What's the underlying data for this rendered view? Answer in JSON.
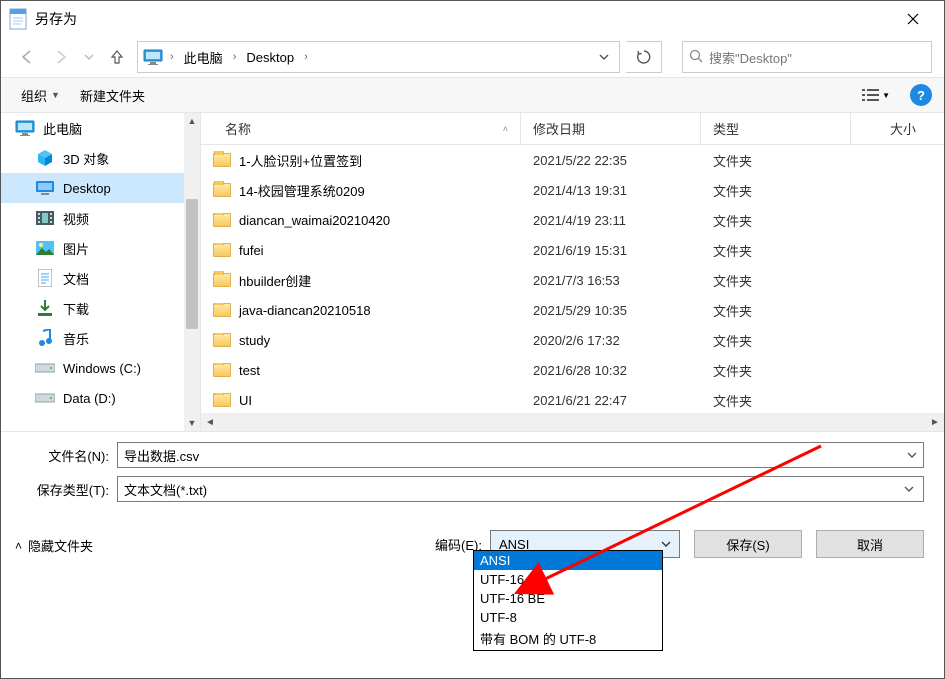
{
  "window": {
    "title": "另存为"
  },
  "nav": {
    "breadcrumb": {
      "root": "此电脑",
      "folder": "Desktop"
    },
    "search_placeholder": "搜索\"Desktop\""
  },
  "toolbar": {
    "organize": "组织",
    "new_folder": "新建文件夹"
  },
  "sidebar": {
    "items": [
      {
        "label": "此电脑",
        "icon": "monitor",
        "indent": 0
      },
      {
        "label": "3D 对象",
        "icon": "cube",
        "indent": 1
      },
      {
        "label": "Desktop",
        "icon": "desktop",
        "indent": 1,
        "selected": true
      },
      {
        "label": "视频",
        "icon": "video",
        "indent": 1
      },
      {
        "label": "图片",
        "icon": "image",
        "indent": 1
      },
      {
        "label": "文档",
        "icon": "doc",
        "indent": 1
      },
      {
        "label": "下载",
        "icon": "download",
        "indent": 1
      },
      {
        "label": "音乐",
        "icon": "music",
        "indent": 1
      },
      {
        "label": "Windows (C:)",
        "icon": "drive",
        "indent": 1
      },
      {
        "label": "Data (D:)",
        "icon": "drive",
        "indent": 1
      }
    ]
  },
  "columns": {
    "name": "名称",
    "date": "修改日期",
    "type": "类型",
    "size": "大小"
  },
  "files": [
    {
      "name": "1-人脸识别+位置签到",
      "date": "2021/5/22 22:35",
      "type": "文件夹"
    },
    {
      "name": "14-校园管理系统0209",
      "date": "2021/4/13 19:31",
      "type": "文件夹"
    },
    {
      "name": "diancan_waimai20210420",
      "date": "2021/4/19 23:11",
      "type": "文件夹"
    },
    {
      "name": "fufei",
      "date": "2021/6/19 15:31",
      "type": "文件夹"
    },
    {
      "name": "hbuilder创建",
      "date": "2021/7/3 16:53",
      "type": "文件夹"
    },
    {
      "name": "java-diancan20210518",
      "date": "2021/5/29 10:35",
      "type": "文件夹"
    },
    {
      "name": "study",
      "date": "2020/2/6 17:32",
      "type": "文件夹"
    },
    {
      "name": "test",
      "date": "2021/6/28 10:32",
      "type": "文件夹"
    },
    {
      "name": "UI",
      "date": "2021/6/21 22:47",
      "type": "文件夹"
    }
  ],
  "form": {
    "filename_label": "文件名(N):",
    "filename_value": "导出数据.csv",
    "filetype_label": "保存类型(T):",
    "filetype_value": "文本文档(*.txt)",
    "encoding_label": "编码(E):",
    "encoding_value": "ANSI",
    "encoding_options": [
      "ANSI",
      "UTF-16 LE",
      "UTF-16 BE",
      "UTF-8",
      "带有 BOM 的 UTF-8"
    ],
    "hidden_folders": "隐藏文件夹",
    "save_button": "保存(S)",
    "cancel_button": "取消"
  }
}
